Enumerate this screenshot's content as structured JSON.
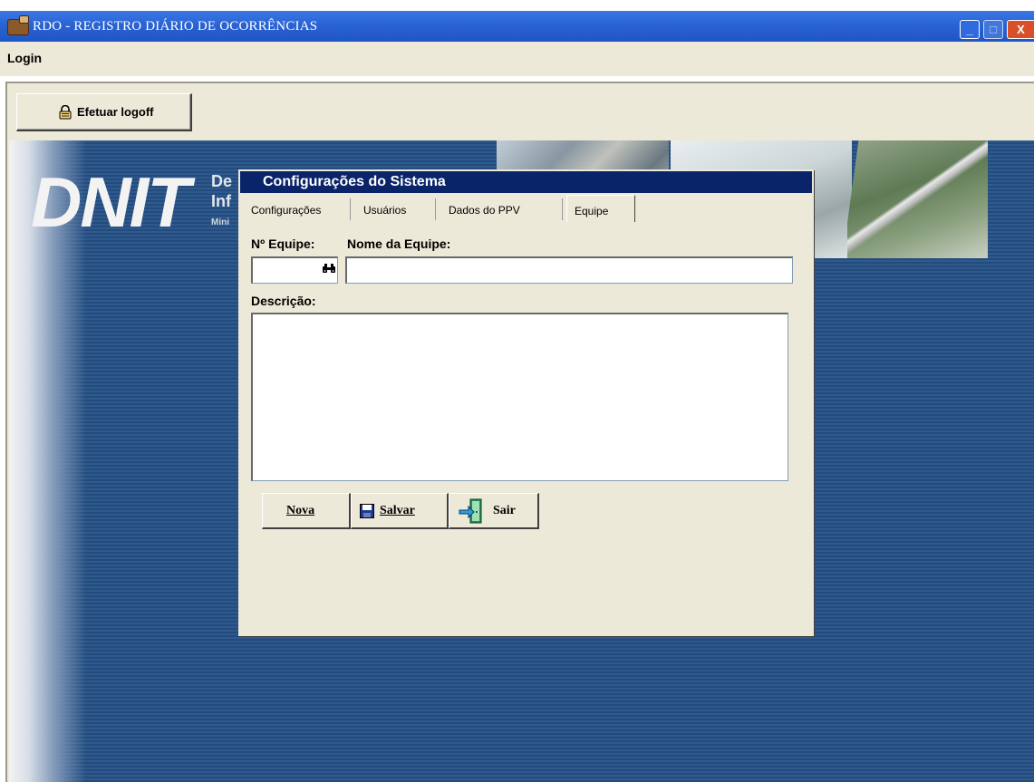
{
  "window": {
    "title": "RDO - REGISTRO DIÁRIO DE OCORRÊNCIAS",
    "minimize_glyph": "_",
    "maximize_glyph": "□",
    "close_glyph": "X"
  },
  "menu": {
    "items": [
      {
        "label": "Login"
      }
    ]
  },
  "toolbar": {
    "logoff_label": "Efetuar logoff",
    "logoff_icon": "lock-icon"
  },
  "background": {
    "logo": "DNIT",
    "line1": "De",
    "line2": "Inf",
    "line3": "Mini"
  },
  "dialog": {
    "title": "Configurações do Sistema",
    "tabs": [
      {
        "label": "Configurações"
      },
      {
        "label": "Usuários"
      },
      {
        "label": "Dados do PPV"
      },
      {
        "label": "Equipe",
        "active": true
      }
    ],
    "team_number_label": "Nº Equipe:",
    "team_name_label": "Nome da Equipe:",
    "team_number_value": "",
    "team_name_value": "",
    "description_label": "Descrição:",
    "description_value": "",
    "buttons": {
      "new": "Nova",
      "save": "Salvar",
      "exit": "Sair"
    }
  },
  "colors": {
    "titlebar": "#2a63d3",
    "dialog_title": "#0a246a",
    "face": "#ece9d8",
    "desktop_blue": "#2e5a8e"
  }
}
